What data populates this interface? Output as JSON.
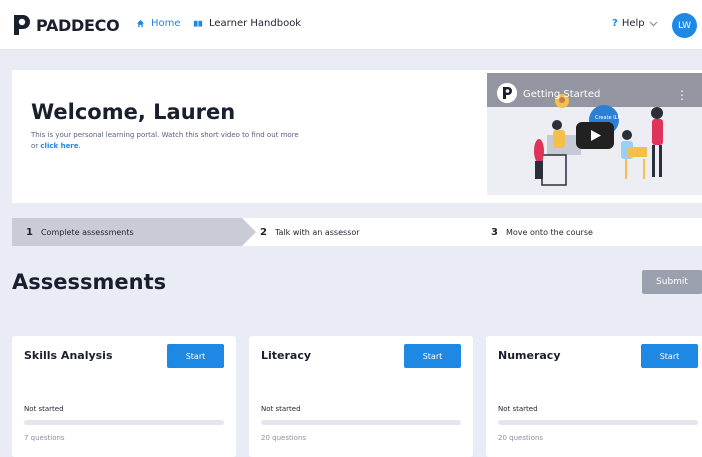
{
  "header": {
    "logo_text": "PADDECO",
    "nav": [
      {
        "label": "Home",
        "icon": "home-icon",
        "color": "#1e88e5"
      },
      {
        "label": "Learner Handbook",
        "icon": "book-icon"
      }
    ],
    "help_label": "Help",
    "avatar_initials": "LW"
  },
  "welcome": {
    "title": "Welcome, Lauren",
    "intro_text": "This is your personal learning portal. Watch this short video to find out more or ",
    "link_text": "click here",
    "intro_end": "."
  },
  "video": {
    "title": "Getting Started",
    "overlay_text": "Create ILP"
  },
  "steps": [
    {
      "number": "1",
      "label": "Complete assessments",
      "active": true
    },
    {
      "number": "2",
      "label": "Talk with an assessor",
      "active": false
    },
    {
      "number": "3",
      "label": "Move onto the course",
      "active": false
    }
  ],
  "assessments": {
    "heading": "Assessments",
    "submit_label": "Submit",
    "cards": [
      {
        "title": "Skills Analysis",
        "button": "Start",
        "status": "Not started",
        "progress": 0,
        "count": "7 questions"
      },
      {
        "title": "Literacy",
        "button": "Start",
        "status": "Not started",
        "progress": 0,
        "count": "20 questions"
      },
      {
        "title": "Numeracy",
        "button": "Start",
        "status": "Not started",
        "progress": 0,
        "count": "20 questions"
      }
    ]
  },
  "colors": {
    "accent": "#1e88e5",
    "page_bg": "#e9ecf4",
    "active_step": "#c9ccd4",
    "submit_disabled": "#9aa0ad"
  }
}
